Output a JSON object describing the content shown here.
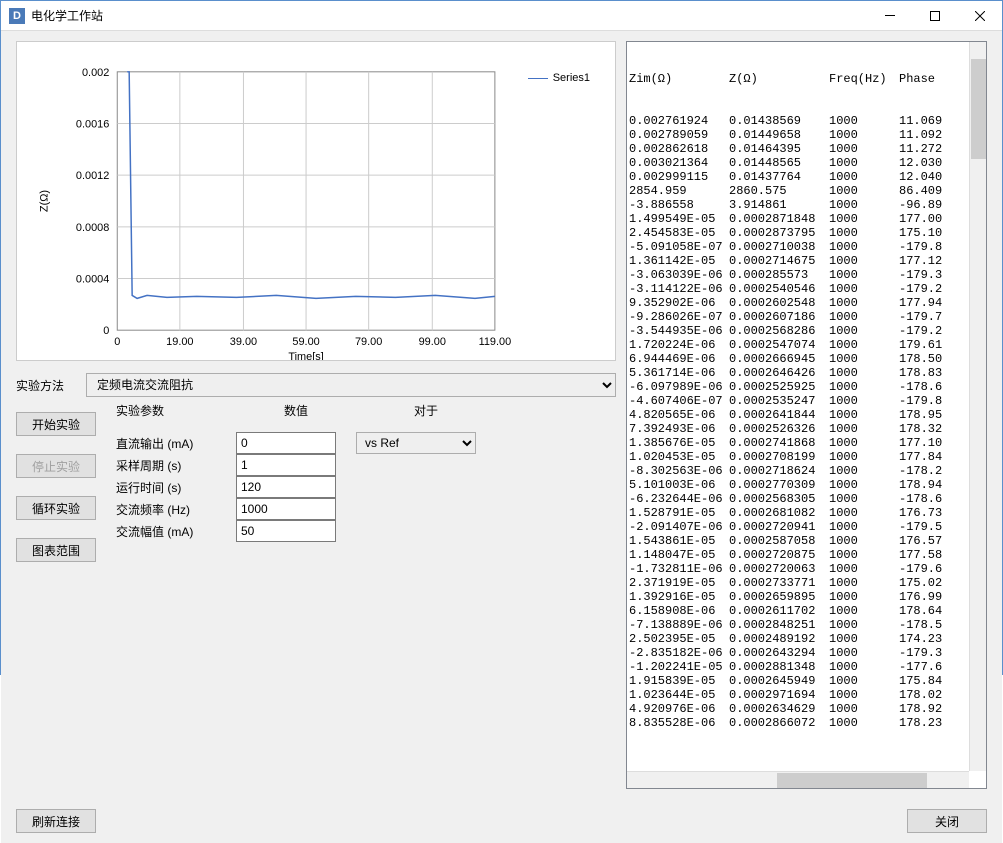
{
  "window": {
    "title": "电化学工作站",
    "icon_letter": "D"
  },
  "chart_data": {
    "type": "line",
    "title": "",
    "xlabel": "Time[s]",
    "ylabel": "Z(Ω)",
    "xlim": [
      0,
      119
    ],
    "ylim": [
      0,
      0.002
    ],
    "xticks": [
      0,
      19.0,
      39.0,
      59.0,
      79.0,
      99.0,
      119.0
    ],
    "yticks": [
      0,
      0.0004,
      0.0008,
      0.0012,
      0.0016,
      0.002
    ],
    "series": [
      {
        "name": "Series1",
        "color": "#4472c4"
      }
    ],
    "legend": {
      "label": "Series1"
    }
  },
  "method": {
    "label": "实验方法",
    "selected": "定频电流交流阻抗"
  },
  "buttons": {
    "start": "开始实验",
    "stop": "停止实验",
    "loop": "循环实验",
    "chart_range": "图表范围",
    "refresh": "刷新连接",
    "close": "关闭"
  },
  "params": {
    "header_param": "实验参数",
    "header_value": "数值",
    "header_for": "对于",
    "ref_selected": "vs Ref",
    "rows": [
      {
        "label": "直流输出 (mA)",
        "value": "0"
      },
      {
        "label": "采样周期 (s)",
        "value": "1"
      },
      {
        "label": "运行时间 (s)",
        "value": "120"
      },
      {
        "label": "交流频率 (Hz)",
        "value": "1000"
      },
      {
        "label": "交流幅值 (mA)",
        "value": "50"
      }
    ]
  },
  "grid": {
    "headers": [
      "Zim(Ω)",
      "Z(Ω)",
      "Freq(Hz)",
      "Phase"
    ],
    "rows": [
      [
        "0.002761924",
        "0.01438569",
        "1000",
        "11.069"
      ],
      [
        "0.002789059",
        "0.01449658",
        "1000",
        "11.092"
      ],
      [
        "0.002862618",
        "0.01464395",
        "1000",
        "11.272"
      ],
      [
        "0.003021364",
        "0.01448565",
        "1000",
        "12.030"
      ],
      [
        "0.002999115",
        "0.01437764",
        "1000",
        "12.040"
      ],
      [
        "2854.959",
        "2860.575",
        "1000",
        "86.409"
      ],
      [
        "-3.886558",
        "3.914861",
        "1000",
        "-96.89"
      ],
      [
        "1.499549E-05",
        "0.0002871848",
        "1000",
        "177.00"
      ],
      [
        "2.454583E-05",
        "0.0002873795",
        "1000",
        "175.10"
      ],
      [
        "-5.091058E-07",
        "0.0002710038",
        "1000",
        "-179.8"
      ],
      [
        "1.361142E-05",
        "0.0002714675",
        "1000",
        "177.12"
      ],
      [
        "-3.063039E-06",
        "0.000285573",
        "1000",
        "-179.3"
      ],
      [
        "-3.114122E-06",
        "0.0002540546",
        "1000",
        "-179.2"
      ],
      [
        "9.352902E-06",
        "0.0002602548",
        "1000",
        "177.94"
      ],
      [
        "-9.286026E-07",
        "0.0002607186",
        "1000",
        "-179.7"
      ],
      [
        "-3.544935E-06",
        "0.0002568286",
        "1000",
        "-179.2"
      ],
      [
        "1.720224E-06",
        "0.0002547074",
        "1000",
        "179.61"
      ],
      [
        "6.944469E-06",
        "0.0002666945",
        "1000",
        "178.50"
      ],
      [
        "5.361714E-06",
        "0.0002646426",
        "1000",
        "178.83"
      ],
      [
        "-6.097989E-06",
        "0.0002525925",
        "1000",
        "-178.6"
      ],
      [
        "-4.607406E-07",
        "0.0002535247",
        "1000",
        "-179.8"
      ],
      [
        "4.820565E-06",
        "0.0002641844",
        "1000",
        "178.95"
      ],
      [
        "7.392493E-06",
        "0.0002526326",
        "1000",
        "178.32"
      ],
      [
        "1.385676E-05",
        "0.0002741868",
        "1000",
        "177.10"
      ],
      [
        "1.020453E-05",
        "0.0002708199",
        "1000",
        "177.84"
      ],
      [
        "-8.302563E-06",
        "0.0002718624",
        "1000",
        "-178.2"
      ],
      [
        "5.101003E-06",
        "0.0002770309",
        "1000",
        "178.94"
      ],
      [
        "-6.232644E-06",
        "0.0002568305",
        "1000",
        "-178.6"
      ],
      [
        "1.528791E-05",
        "0.0002681082",
        "1000",
        "176.73"
      ],
      [
        "-2.091407E-06",
        "0.0002720941",
        "1000",
        "-179.5"
      ],
      [
        "1.543861E-05",
        "0.0002587058",
        "1000",
        "176.57"
      ],
      [
        "1.148047E-05",
        "0.0002720875",
        "1000",
        "177.58"
      ],
      [
        "-1.732811E-06",
        "0.0002720063",
        "1000",
        "-179.6"
      ],
      [
        "2.371919E-05",
        "0.0002733771",
        "1000",
        "175.02"
      ],
      [
        "1.392916E-05",
        "0.0002659895",
        "1000",
        "176.99"
      ],
      [
        "6.158908E-06",
        "0.0002611702",
        "1000",
        "178.64"
      ],
      [
        "-7.138889E-06",
        "0.0002848251",
        "1000",
        "-178.5"
      ],
      [
        "2.502395E-05",
        "0.0002489192",
        "1000",
        "174.23"
      ],
      [
        "-2.835182E-06",
        "0.0002643294",
        "1000",
        "-179.3"
      ],
      [
        "-1.202241E-05",
        "0.0002881348",
        "1000",
        "-177.6"
      ],
      [
        "1.915839E-05",
        "0.0002645949",
        "1000",
        "175.84"
      ],
      [
        "1.023644E-05",
        "0.0002971694",
        "1000",
        "178.02"
      ],
      [
        "4.920976E-06",
        "0.0002634629",
        "1000",
        "178.92"
      ],
      [
        "8.835528E-06",
        "0.0002866072",
        "1000",
        "178.23"
      ]
    ]
  }
}
